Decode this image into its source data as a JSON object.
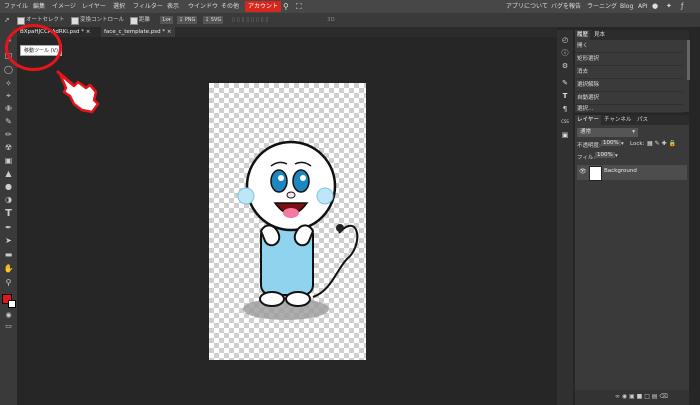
{
  "menu": {
    "items": [
      "ファイル",
      "編集",
      "イメージ",
      "レイヤー",
      "選択",
      "フィルター",
      "表示",
      "ウインドウ",
      "その他",
      "アカウント"
    ],
    "right_links": [
      "アプリについて",
      "バグを報告",
      "ラーニング",
      "Blog",
      "API"
    ]
  },
  "options": {
    "autoselect": "オートセレクト",
    "transform": "変換コントロール",
    "distance": "距離",
    "zoom": "1x",
    "png": "PNG",
    "svg": "SVG",
    "three_d": "3D"
  },
  "tabs": [
    "BXpaHJCCAAdRKi.psd *",
    "face_c_template.psd *"
  ],
  "tooltip": "移動ツール (V)",
  "history": {
    "tabs": [
      "履歴",
      "見本"
    ],
    "items": [
      "開く",
      "矩形選択",
      "消去",
      "選択解除",
      "自動選択",
      "選択..."
    ]
  },
  "layers": {
    "tabs": [
      "レイヤー",
      "チャンネル",
      "パス"
    ],
    "blend_mode": "通常",
    "opacity_label": "不透明度:",
    "opacity_value": "100%",
    "lock_label": "Lock:",
    "fill_label": "フィル:",
    "fill_value": "100%",
    "layer_name": "Background"
  },
  "colors": {
    "accent": "#d9261c",
    "foreground": "#e8141b",
    "background_swatch": "#ffffff"
  }
}
